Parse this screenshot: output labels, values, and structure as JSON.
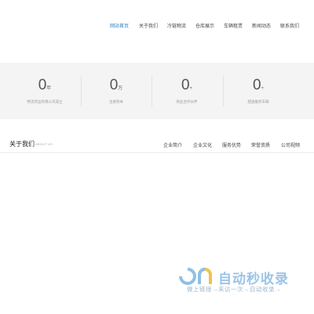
{
  "nav": {
    "items": [
      {
        "label": "网站首页",
        "active": true
      },
      {
        "label": "关于我们",
        "active": false
      },
      {
        "label": "冷链物流",
        "active": false
      },
      {
        "label": "仓库展示",
        "active": false
      },
      {
        "label": "车辆租赁",
        "active": false
      },
      {
        "label": "新闻动态",
        "active": false
      },
      {
        "label": "联系我们",
        "active": false
      }
    ],
    "active_color": "#2a7cc7"
  },
  "stats": [
    {
      "value": "0",
      "unit": "年",
      "label": "物流货运有限公司成立"
    },
    {
      "value": "0",
      "unit": "万",
      "label": "注册资本"
    },
    {
      "value": "0",
      "unit": "+",
      "label": "商业合作伙伴"
    },
    {
      "value": "0",
      "unit": "+",
      "label": "配送服务车辆"
    }
  ],
  "about": {
    "title": "关于我们",
    "subtitle": "ABOUT US",
    "tabs": [
      "企业简介",
      "企业文化",
      "服务优势",
      "荣誉资质",
      "公司视频"
    ]
  },
  "watermark": {
    "text": "自动秒收录",
    "tagline": "做上链接→来访一次→自动收录→",
    "color": "#9bc4e8"
  }
}
